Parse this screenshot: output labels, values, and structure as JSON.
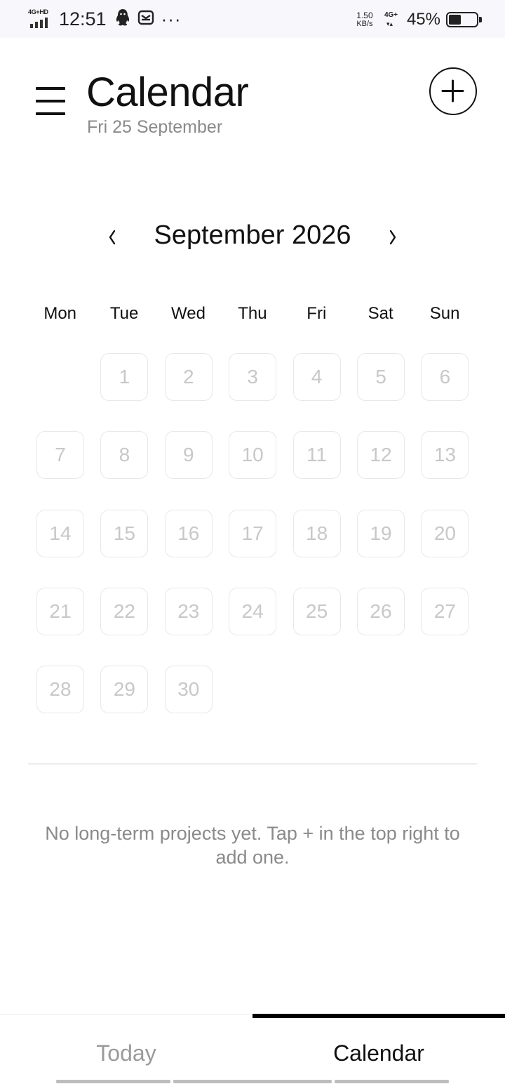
{
  "status_bar": {
    "network_type_label": "4G+HD",
    "time": "12:51",
    "overflow_dots": "···",
    "speed_value": "1.50",
    "speed_unit": "KB/s",
    "mobile_data_label": "4G+",
    "battery_percent": "45%",
    "battery_level": 0.45,
    "icons": [
      "signal-icon",
      "qq-penguin-icon",
      "mail-icon",
      "battery-icon"
    ]
  },
  "header": {
    "title": "Calendar",
    "date_subtitle": "Fri 25 September",
    "menu_icon": "hamburger-menu-icon",
    "add_icon": "plus-circle-icon"
  },
  "month_nav": {
    "label": "September 2026",
    "prev_icon": "chevron-left-icon",
    "next_icon": "chevron-right-icon"
  },
  "weekdays": [
    "Mon",
    "Tue",
    "Wed",
    "Thu",
    "Fri",
    "Sat",
    "Sun"
  ],
  "calendar_days": {
    "row1": [
      "1",
      "2",
      "3",
      "4",
      "5",
      "6"
    ],
    "row2": [
      "7",
      "8",
      "9",
      "10",
      "11",
      "12",
      "13"
    ],
    "row3": [
      "14",
      "15",
      "16",
      "17",
      "18",
      "19",
      "20"
    ],
    "row4": [
      "21",
      "22",
      "23",
      "24",
      "25",
      "26",
      "27"
    ],
    "row5": [
      "28",
      "29",
      "30"
    ]
  },
  "empty_state": {
    "message": "No long-term projects yet. Tap + in the top right to add one."
  },
  "tabs": [
    {
      "label": "Today",
      "active": false
    },
    {
      "label": "Calendar",
      "active": true
    }
  ],
  "colors": {
    "text_primary": "#111111",
    "text_secondary": "#8a8a8a",
    "day_text": "#c8c8c8",
    "day_border": "#e8e8e8",
    "tab_indicator": "#000000",
    "status_bar_bg": "#f8f7fb"
  }
}
